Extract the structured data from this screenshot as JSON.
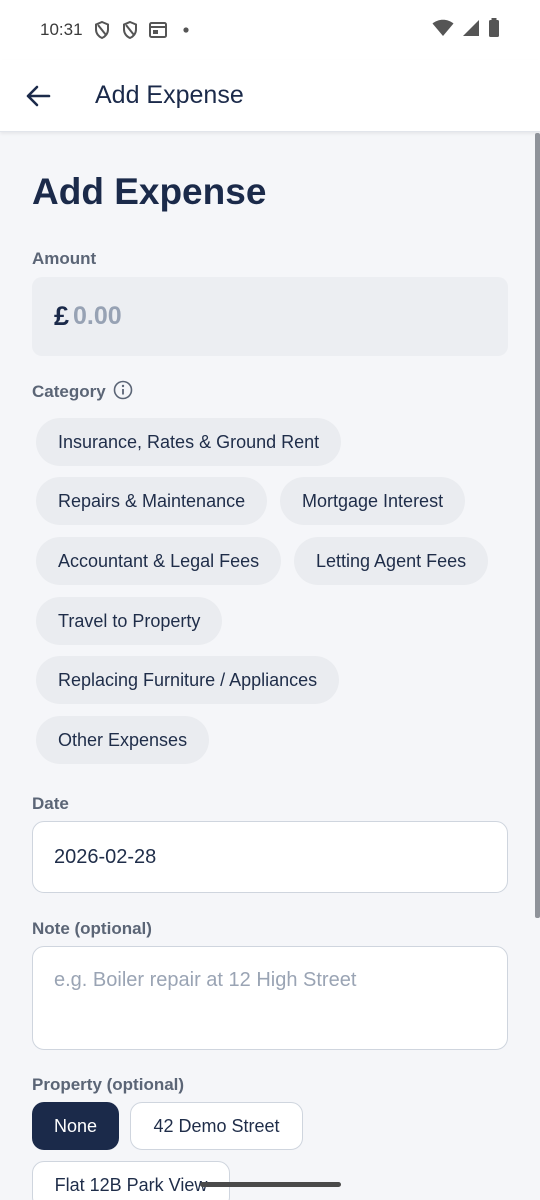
{
  "status_bar": {
    "time": "10:31",
    "icons": [
      "shield-icon",
      "shield-icon",
      "calendar-icon",
      "dot-icon"
    ],
    "right_icons": [
      "wifi-icon",
      "signal-icon",
      "battery-icon"
    ]
  },
  "app_bar": {
    "title": "Add Expense",
    "back_icon": "arrow-left-icon"
  },
  "page": {
    "heading": "Add Expense"
  },
  "amount": {
    "label": "Amount",
    "currency": "£",
    "placeholder": "0.00"
  },
  "category": {
    "label": "Category",
    "info_icon": "info-icon",
    "options": [
      "Insurance, Rates & Ground Rent",
      "Repairs & Maintenance",
      "Mortgage Interest",
      "Accountant & Legal Fees",
      "Letting Agent Fees",
      "Travel to Property",
      "Replacing Furniture / Appliances",
      "Other Expenses"
    ]
  },
  "date": {
    "label": "Date",
    "value": "2026-02-28"
  },
  "note": {
    "label": "Note (optional)",
    "placeholder": "e.g. Boiler repair at 12 High Street"
  },
  "property": {
    "label": "Property (optional)",
    "options": [
      "None",
      "42 Demo Street",
      "Flat 12B Park View"
    ],
    "selected": "None"
  },
  "colors": {
    "primary": "#1b2a4a",
    "chip_bg": "#eaecf0",
    "background": "#f5f6f9",
    "label": "#5b6576",
    "placeholder": "#97a2b4"
  }
}
